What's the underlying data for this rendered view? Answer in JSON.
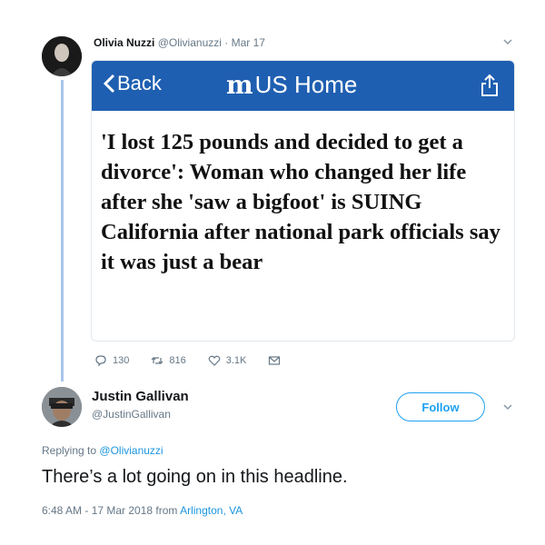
{
  "tweet": {
    "author_name": "Olivia Nuzzi",
    "handle": "@Olivianuzzi",
    "date_sep": "·",
    "date": "Mar 17",
    "card": {
      "back_label": "Back",
      "logo_mark": "m",
      "logo_text": "US Home",
      "headline": "'I lost 125 pounds and decided to get a divorce': Woman who changed her life after she 'saw a bigfoot' is SUING California after national park officials say it was just a bear"
    },
    "actions": {
      "replies": "130",
      "retweets": "816",
      "likes": "3.1K"
    }
  },
  "reply": {
    "author_name": "Justin Gallivan",
    "handle": "@JustinGallivan",
    "follow_label": "Follow",
    "replying_prefix": "Replying to",
    "replying_handle": "@Olivianuzzi",
    "text": "There’s a lot going on in this headline.",
    "timestamp": "6:48 AM - 17 Mar 2018 from",
    "location": "Arlington, VA"
  },
  "colors": {
    "card_header": "#1f5fb1",
    "link": "#1b95e0",
    "follow": "#1da1f2",
    "thread_line": "#a9c5ea"
  },
  "icons": [
    "chevron-down-icon",
    "back-arrow-icon",
    "share-icon",
    "reply-icon",
    "retweet-icon",
    "like-icon",
    "message-icon"
  ]
}
